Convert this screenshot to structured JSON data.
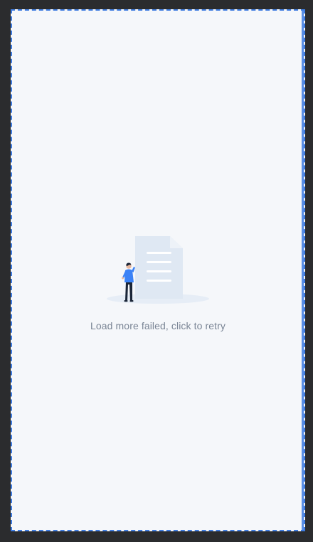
{
  "colors": {
    "background_outer": "#2b2c2e",
    "screen_background": "#f5f7fa",
    "frame_border": "#3d7be0",
    "document_fill": "#dde7f2",
    "person_shirt": "#3b82f6",
    "person_pants": "#1a2537",
    "message_text": "#7a8595"
  },
  "empty_state": {
    "illustration_icon": "document-with-person-illustration",
    "message": "Load more failed, click to retry"
  }
}
